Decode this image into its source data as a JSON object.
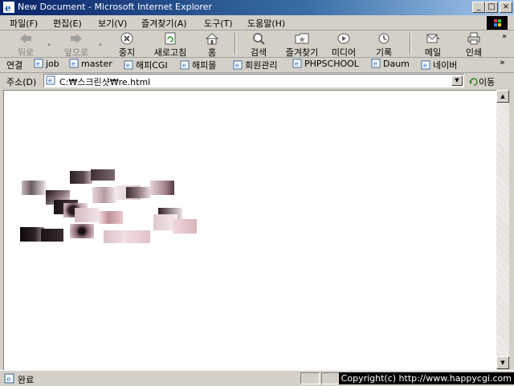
{
  "window": {
    "title": "New Document - Microsoft Internet Explorer"
  },
  "menu": [
    "파일(F)",
    "편집(E)",
    "보기(V)",
    "즐겨찾기(A)",
    "도구(T)",
    "도움말(H)"
  ],
  "toolbar": {
    "back": "뒤로",
    "forward": "앞으로",
    "stop": "중지",
    "refresh": "새로고침",
    "home": "홈",
    "search": "검색",
    "favorites": "즐겨찾기",
    "media": "미디어",
    "history": "기록",
    "mail": "메일",
    "print": "인쇄"
  },
  "links": {
    "label": "연결",
    "items": [
      "job",
      "master",
      "해피CGI",
      "해피몰",
      "회원관리",
      "PHPSCHOOL",
      "Daum",
      "네이버"
    ]
  },
  "address": {
    "label": "주소(D)",
    "value": "C:₩스크린샷₩re.html",
    "go": "이동"
  },
  "status": {
    "text": "완료",
    "copyright": "Copyright(c) http://www.happycgi.com"
  },
  "colors": {
    "title_start": "#0a246a",
    "title_end": "#a6caf0",
    "chrome": "#d4d0c8"
  }
}
